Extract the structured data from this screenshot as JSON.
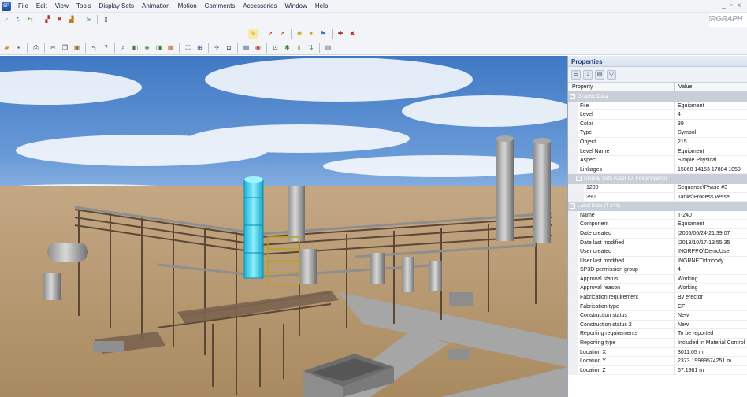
{
  "app": {
    "icon_label": "SP",
    "window_controls": "_ ▫ x",
    "brand": "INTERGRAPH"
  },
  "menu": [
    "File",
    "Edit",
    "View",
    "Tools",
    "Display Sets",
    "Animation",
    "Motion",
    "Comments",
    "Accessories",
    "Window",
    "Help"
  ],
  "toolbars": {
    "row1": [
      {
        "name": "zoom-tool-icon",
        "glyph": "⌕",
        "color": "#2e6bb5"
      },
      {
        "name": "rotate-tool-icon",
        "glyph": "↻",
        "color": "#2e6bb5"
      },
      {
        "name": "walk-tool-icon",
        "glyph": "⇆",
        "color": "#5b8d2e"
      },
      {
        "sep": true
      },
      {
        "name": "select-tool-icon",
        "glyph": "▞",
        "color": "#b03a2e"
      },
      {
        "name": "hide-tool-icon",
        "glyph": "✖",
        "color": "#b03a2e"
      },
      {
        "name": "measure-tool-icon",
        "glyph": "▟",
        "color": "#c27b17"
      },
      {
        "sep": true
      },
      {
        "name": "export-icon",
        "glyph": "⇲",
        "color": "#2f8a3b"
      },
      {
        "sep": true
      },
      {
        "name": "new-document-icon",
        "glyph": "▯",
        "color": "#444"
      }
    ],
    "row2": [
      {
        "name": "highlight-icon",
        "glyph": "✎",
        "color": "#c8a215",
        "bg": "#fbe9a8"
      },
      {
        "sep": true
      },
      {
        "name": "pointer-tool-icon",
        "glyph": "➚",
        "color": "#c23a26"
      },
      {
        "name": "pointer-multi-icon",
        "glyph": "➚",
        "color": "#c23a26"
      },
      {
        "sep": true
      },
      {
        "name": "sun-icon",
        "glyph": "✺",
        "color": "#d5a113"
      },
      {
        "name": "light-icon",
        "glyph": "✦",
        "color": "#d5a113"
      },
      {
        "name": "flag-icon",
        "glyph": "⚑",
        "color": "#3d6fb8"
      },
      {
        "sep": true
      },
      {
        "name": "markup-icon",
        "glyph": "✚",
        "color": "#8b2a2a"
      },
      {
        "name": "close-markup-icon",
        "glyph": "✖",
        "color": "#cc2222"
      }
    ],
    "row3": [
      {
        "name": "open-icon",
        "glyph": "▰",
        "color": "#c9911a"
      },
      {
        "name": "save-icon",
        "glyph": "▪",
        "color": "#2d4f8f"
      },
      {
        "sep": true
      },
      {
        "name": "print-icon",
        "glyph": "⎙",
        "color": "#444"
      },
      {
        "sep": true
      },
      {
        "name": "cut-icon",
        "glyph": "✂",
        "color": "#444"
      },
      {
        "name": "copy-icon",
        "glyph": "❐",
        "color": "#444"
      },
      {
        "name": "paste-icon",
        "glyph": "▣",
        "color": "#8a6a2a"
      },
      {
        "sep": true
      },
      {
        "name": "select-icon",
        "glyph": "↖",
        "color": "#444"
      },
      {
        "name": "help-icon",
        "glyph": "?",
        "color": "#2d4f8f"
      },
      {
        "sep": true
      },
      {
        "name": "search-icon",
        "glyph": "⌕",
        "color": "#2d4f8f"
      },
      {
        "name": "view-front-icon",
        "glyph": "◧",
        "color": "#3b7a3b"
      },
      {
        "name": "view-iso-icon",
        "glyph": "◈",
        "color": "#3b7a3b"
      },
      {
        "name": "view-top-icon",
        "glyph": "◨",
        "color": "#3b7a3b"
      },
      {
        "name": "view-side-icon",
        "glyph": "▦",
        "color": "#c46a1a"
      },
      {
        "sep": true
      },
      {
        "name": "zoom-extents-icon",
        "glyph": "⛶",
        "color": "#2d4f8f"
      },
      {
        "name": "zoom-window-icon",
        "glyph": "⊞",
        "color": "#2d4f8f"
      },
      {
        "sep": true
      },
      {
        "name": "fly-icon",
        "glyph": "✈",
        "color": "#2d4f8f"
      },
      {
        "name": "camera-icon",
        "glyph": "◘",
        "color": "#444"
      },
      {
        "sep": true
      },
      {
        "name": "layers-icon",
        "glyph": "▤",
        "color": "#2d4f8f"
      },
      {
        "name": "display-set-icon",
        "glyph": "◉",
        "color": "#b03a2e"
      },
      {
        "sep": true
      },
      {
        "name": "clip-icon",
        "glyph": "⊡",
        "color": "#444"
      },
      {
        "name": "annotation-icon",
        "glyph": "✱",
        "color": "#2f8a3b"
      },
      {
        "name": "tag-icon",
        "glyph": "⬆",
        "color": "#2f8a3b"
      },
      {
        "name": "measure-icon",
        "glyph": "⇅",
        "color": "#2f8a3b"
      },
      {
        "sep": true
      },
      {
        "name": "grid-icon",
        "glyph": "▥",
        "color": "#444"
      }
    ]
  },
  "properties": {
    "title": "Properties",
    "header": {
      "property": "Property",
      "value": "Value"
    },
    "sections": [
      {
        "label": "Graphic Data",
        "sub": false,
        "rows": [
          {
            "name": "File",
            "value": "Equipment"
          },
          {
            "name": "Level",
            "value": "4"
          },
          {
            "name": "Color",
            "value": "39"
          },
          {
            "name": "Type",
            "value": "Symbol"
          },
          {
            "name": "Object",
            "value": "215"
          },
          {
            "name": "Level Name",
            "value": "Equipment"
          },
          {
            "name": "Aspect",
            "value": "Simple Physical"
          },
          {
            "name": "Linkages",
            "value": "15860 14153 17084 1059"
          }
        ]
      },
      {
        "label": "Display Sets (User ID: Folder\\Name)",
        "sub": true,
        "rows": [
          {
            "name": "1200",
            "value": "Sequence\\Phase #3"
          },
          {
            "name": "390",
            "value": "Tanks\\Process vessel"
          }
        ]
      },
      {
        "label": "Label Data (T-240)",
        "sub": false,
        "rows": [
          {
            "name": "Name",
            "value": "T-240"
          },
          {
            "name": "Component",
            "value": "Equipment"
          },
          {
            "name": "Date created",
            "value": "|2005/06/24-21:39:07"
          },
          {
            "name": "Date last modified",
            "value": "|2013/10/17-13:55:35"
          },
          {
            "name": "User created",
            "value": "INGRPPO\\DemoUser"
          },
          {
            "name": "User last modified",
            "value": "INGRNET\\dmoody"
          },
          {
            "name": "SP3D permission group",
            "value": "4"
          },
          {
            "name": "Approval status",
            "value": "Working"
          },
          {
            "name": "Approval reason",
            "value": "Working"
          },
          {
            "name": "Fabrication requirement",
            "value": "By erector"
          },
          {
            "name": "Fabrication type",
            "value": "CF"
          },
          {
            "name": "Construction status",
            "value": "New"
          },
          {
            "name": "Construction status 2",
            "value": "New"
          },
          {
            "name": "Reporting requirements",
            "value": "To be reported"
          },
          {
            "name": "Reporting type",
            "value": "Included in Material Control"
          },
          {
            "name": "Location X",
            "value": "3011.05 m"
          },
          {
            "name": "Location Y",
            "value": "2373.19989574251 m"
          },
          {
            "name": "Location Z",
            "value": "67.1981 m"
          }
        ]
      }
    ]
  },
  "colors": {
    "selected_tank": "#38d0ee",
    "ground": "#b59a72",
    "road": "#a8a8a8",
    "steel": "#6a5444"
  }
}
